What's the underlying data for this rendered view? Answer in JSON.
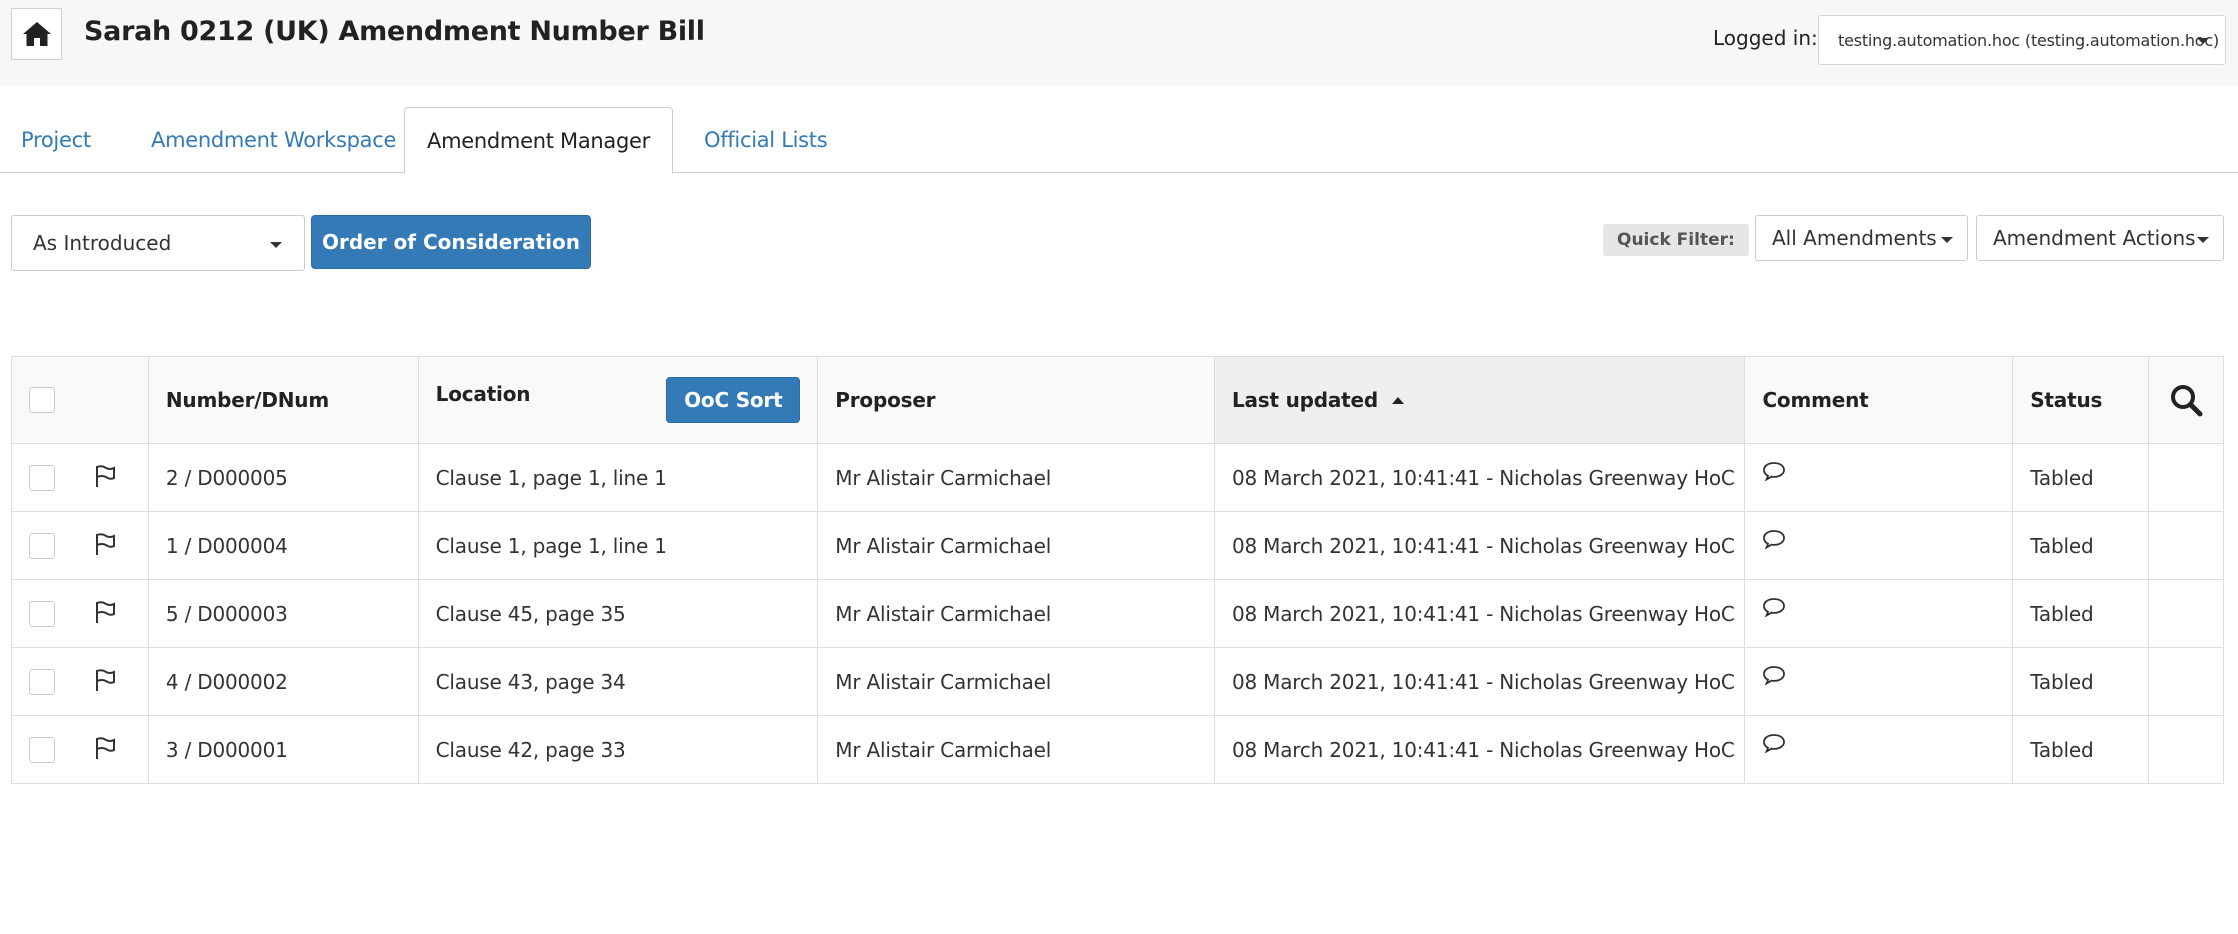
{
  "header": {
    "title": "Sarah 0212 (UK) Amendment Number Bill",
    "logged_in_label": "Logged in:",
    "user": "testing.automation.hoc (testing.automation.hoc)"
  },
  "tabs": [
    {
      "label": "Project",
      "active": false
    },
    {
      "label": "Amendment Workspace",
      "active": false
    },
    {
      "label": "Amendment Manager",
      "active": true
    },
    {
      "label": "Official Lists",
      "active": false
    }
  ],
  "toolbar": {
    "version_select": "As Introduced",
    "ooc_button": "Order of Consideration",
    "quick_filter_label": "Quick Filter:",
    "filter_select": "All Amendments",
    "actions_select": "Amendment Actions"
  },
  "table": {
    "columns": {
      "number": "Number/DNum",
      "location": "Location",
      "ooc_sort": "OoC Sort",
      "proposer": "Proposer",
      "last_updated": "Last updated",
      "comment": "Comment",
      "status": "Status"
    },
    "rows": [
      {
        "number": "2 / D000005",
        "location": "Clause 1, page 1, line 1",
        "proposer": "Mr Alistair Carmichael",
        "last_updated": "08 March 2021, 10:41:41 - Nicholas Greenway HoC",
        "status": "Tabled"
      },
      {
        "number": "1 / D000004",
        "location": "Clause 1, page 1, line 1",
        "proposer": "Mr Alistair Carmichael",
        "last_updated": "08 March 2021, 10:41:41 - Nicholas Greenway HoC",
        "status": "Tabled"
      },
      {
        "number": "5 / D000003",
        "location": "Clause 45, page 35",
        "proposer": "Mr Alistair Carmichael",
        "last_updated": "08 March 2021, 10:41:41 - Nicholas Greenway HoC",
        "status": "Tabled"
      },
      {
        "number": "4 / D000002",
        "location": "Clause 43, page 34",
        "proposer": "Mr Alistair Carmichael",
        "last_updated": "08 March 2021, 10:41:41 - Nicholas Greenway HoC",
        "status": "Tabled"
      },
      {
        "number": "3 / D000001",
        "location": "Clause 42, page 33",
        "proposer": "Mr Alistair Carmichael",
        "last_updated": "08 March 2021, 10:41:41 - Nicholas Greenway HoC",
        "status": "Tabled"
      }
    ]
  },
  "icons": {
    "home": "home-icon",
    "flag": "flag-icon",
    "comment": "comment-icon",
    "search": "search-icon"
  },
  "colors": {
    "primary": "#337ab7",
    "link": "#337ab7",
    "header_bg": "#f7f7f7"
  }
}
